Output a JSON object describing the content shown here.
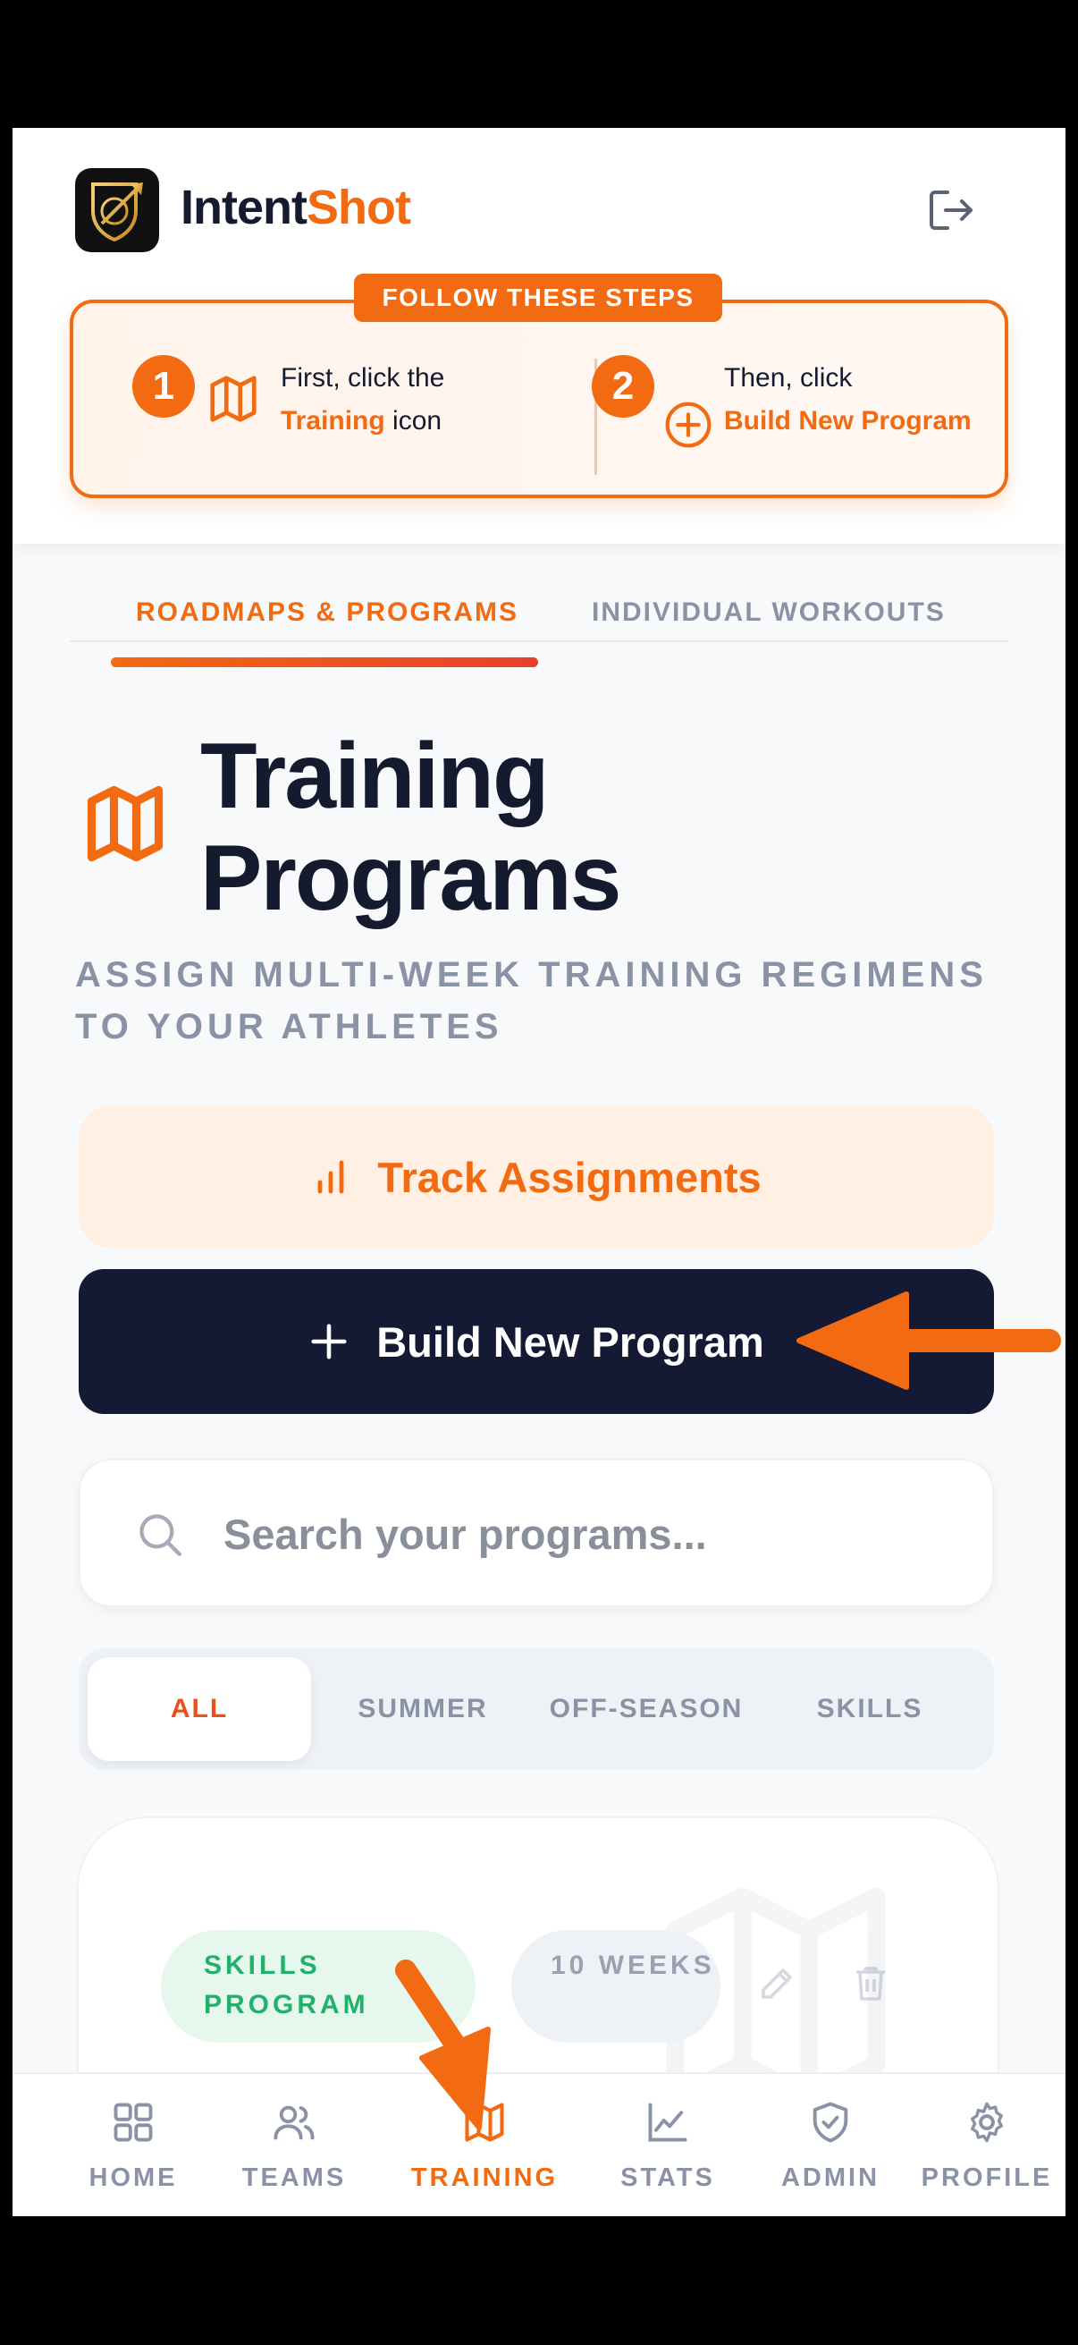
{
  "app": {
    "brand_primary": "Intent",
    "brand_accent": "Shot",
    "accent_color": "#f26a12",
    "dark_color": "#141a33"
  },
  "steps": {
    "badge": "FOLLOW THESE STEPS",
    "step1": {
      "number": "1",
      "prefix": "First, click the",
      "highlight": "Training",
      "suffix": "icon"
    },
    "step2": {
      "number": "2",
      "prefix": "Then, click",
      "highlight": "Build New Program"
    }
  },
  "tabs": [
    {
      "label": "ROADMAPS & PROGRAMS",
      "active": true
    },
    {
      "label": "INDIVIDUAL WORKOUTS",
      "active": false
    }
  ],
  "page": {
    "title_line1": "Training",
    "title_line2": "Programs",
    "subtitle": "ASSIGN MULTI-WEEK TRAINING REGIMENS TO YOUR ATHLETES"
  },
  "actions": {
    "track_label": "Track Assignments",
    "build_label": "Build New Program"
  },
  "search": {
    "placeholder": "Search your programs..."
  },
  "filters": [
    {
      "label": "ALL",
      "active": true
    },
    {
      "label": "SUMMER",
      "active": false
    },
    {
      "label": "OFF-SEASON",
      "active": false
    },
    {
      "label": "SKILLS",
      "active": false
    }
  ],
  "program_card": {
    "type_badge": "SKILLS PROGRAM",
    "duration_badge": "10 WEEKS"
  },
  "nav": [
    {
      "label": "HOME",
      "icon": "grid-icon",
      "active": false
    },
    {
      "label": "TEAMS",
      "icon": "users-icon",
      "active": false
    },
    {
      "label": "TRAINING",
      "icon": "map-icon",
      "active": true
    },
    {
      "label": "STATS",
      "icon": "chart-line-icon",
      "active": false
    },
    {
      "label": "ADMIN",
      "icon": "shield-check-icon",
      "active": false
    },
    {
      "label": "PROFILE",
      "icon": "gear-icon",
      "active": false
    }
  ]
}
